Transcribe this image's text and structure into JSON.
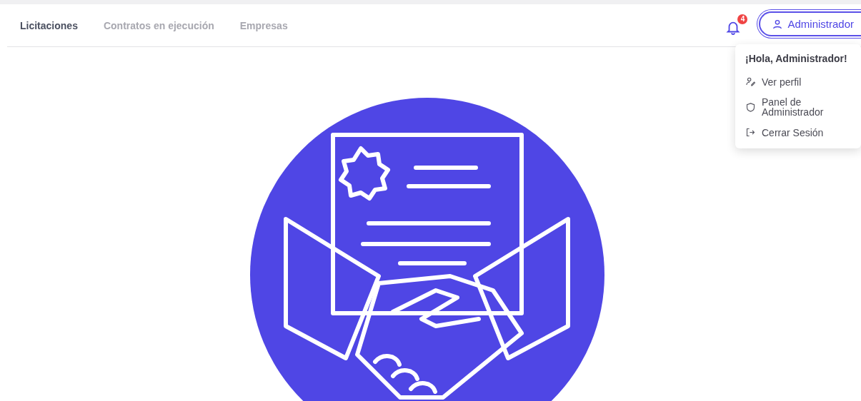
{
  "tabs": [
    {
      "label": "Licitaciones",
      "selected": true
    },
    {
      "label": "Contratos en ejecución",
      "selected": false
    },
    {
      "label": "Empresas",
      "selected": false
    }
  ],
  "notifications": {
    "count": "4"
  },
  "user_button": {
    "label": "Administrador"
  },
  "user_menu": {
    "greeting": "¡Hola, Administrador!",
    "items": [
      {
        "kind": "profile",
        "label": "Ver perfil"
      },
      {
        "kind": "admin",
        "label": "Panel de\nAdministrador"
      },
      {
        "kind": "logout",
        "label": "Cerrar Sesión"
      }
    ]
  }
}
